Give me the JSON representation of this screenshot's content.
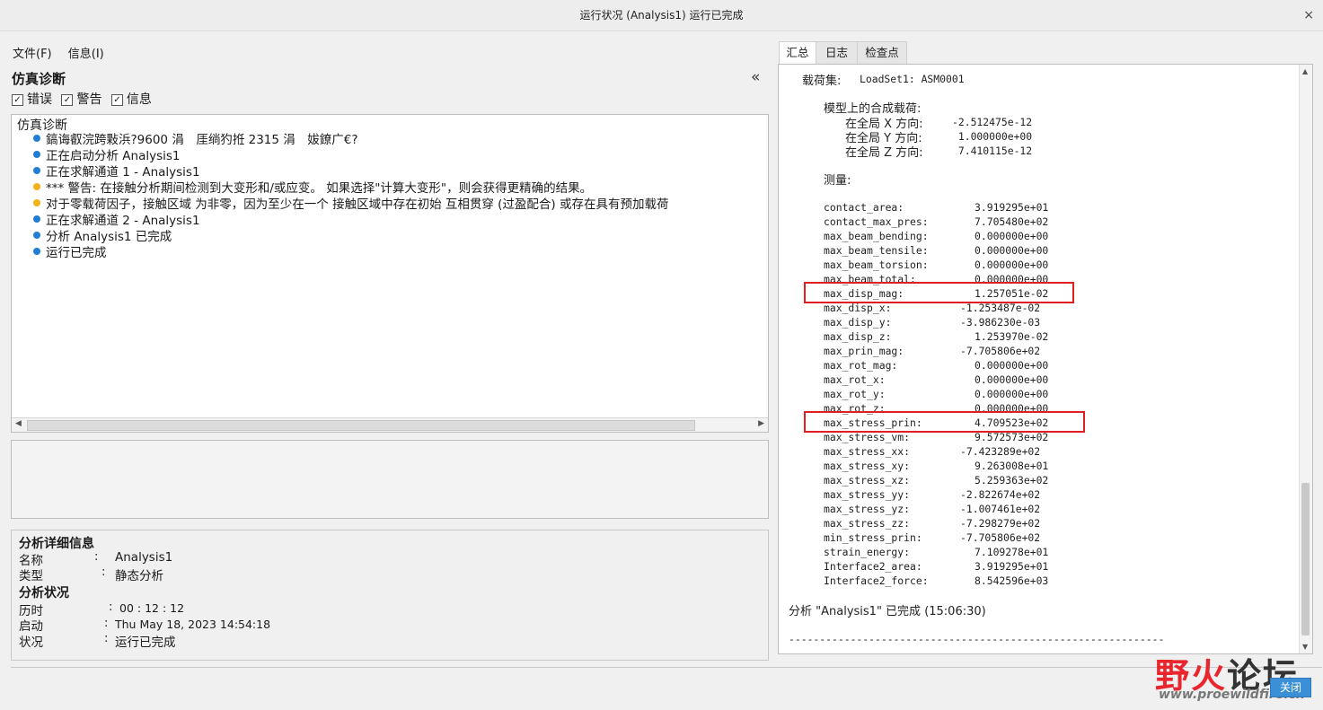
{
  "window": {
    "title": "运行状况 (Analysis1) 运行已完成",
    "close_glyph": "×"
  },
  "menu": {
    "file": "文件(F)",
    "info": "信息(I)"
  },
  "diagnostics": {
    "title": "仿真诊断",
    "collapse_glyph": "«",
    "filters": {
      "errors": "错误",
      "warnings": "警告",
      "info": "信息"
    },
    "tree_root": "仿真诊断",
    "colors": {
      "info": "#1f7fd6",
      "warning": "#f2b21c"
    },
    "messages": [
      {
        "kind": "info",
        "text": "鎬诲叡浣跨敤浜?9600 涓　厓绱犳拰 2315 涓　妭鐐广€?"
      },
      {
        "kind": "info",
        "text": "正在启动分析 Analysis1"
      },
      {
        "kind": "info",
        "text": "正在求解通道 1 - Analysis1"
      },
      {
        "kind": "warning",
        "text": "*** 警告: 在接触分析期间检测到大变形和/或应变。 如果选择\"计算大变形\"，则会获得更精确的结果。"
      },
      {
        "kind": "warning",
        "text": "对于零载荷因子，接触区域 为非零，因为至少在一个 接触区域中存在初始 互相贯穿 (过盈配合) 或存在具有预加载荷"
      },
      {
        "kind": "info",
        "text": "正在求解通道 2 - Analysis1"
      },
      {
        "kind": "info",
        "text": "分析 Analysis1 已完成"
      },
      {
        "kind": "info",
        "text": "运行已完成"
      }
    ]
  },
  "details": {
    "title": "分析详细信息",
    "name_label": "名称",
    "name_value": "Analysis1",
    "type_label": "类型",
    "type_value": "静态分析",
    "status_title": "分析状况",
    "elapsed_label": "历时",
    "elapsed_value": "00 : 12 : 12",
    "start_label": "启动",
    "start_value": "Thu May 18, 2023    14:54:18",
    "state_label": "状况",
    "state_value": "运行已完成"
  },
  "tabs": [
    "汇总",
    "日志",
    "检查点"
  ],
  "summary": {
    "loadset_label": "载荷集:",
    "loadset_value": "LoadSet1: ASM0001",
    "resultant_title": "模型上的合成载荷:",
    "resultants": [
      {
        "label": "在全局 X 方向:",
        "value": "-2.512475e-12"
      },
      {
        "label": "在全局 Y 方向:",
        "value": "1.000000e+00"
      },
      {
        "label": "在全局 Z 方向:",
        "value": "7.410115e-12"
      }
    ],
    "measures_title": "测量:",
    "measures": [
      {
        "name": "contact_area:",
        "value": "3.919295e+01"
      },
      {
        "name": "contact_max_pres:",
        "value": "7.705480e+02"
      },
      {
        "name": "max_beam_bending:",
        "value": "0.000000e+00"
      },
      {
        "name": "max_beam_tensile:",
        "value": "0.000000e+00"
      },
      {
        "name": "max_beam_torsion:",
        "value": "0.000000e+00"
      },
      {
        "name": "max_beam_total:",
        "value": "0.000000e+00"
      },
      {
        "name": "max_disp_mag:",
        "value": "1.257051e-02",
        "highlight": true
      },
      {
        "name": "max_disp_x:",
        "value": "-1.253487e-02"
      },
      {
        "name": "max_disp_y:",
        "value": "-3.986230e-03"
      },
      {
        "name": "max_disp_z:",
        "value": "1.253970e-02"
      },
      {
        "name": "max_prin_mag:",
        "value": "-7.705806e+02"
      },
      {
        "name": "max_rot_mag:",
        "value": "0.000000e+00"
      },
      {
        "name": "max_rot_x:",
        "value": "0.000000e+00"
      },
      {
        "name": "max_rot_y:",
        "value": "0.000000e+00"
      },
      {
        "name": "max_rot_z:",
        "value": "0.000000e+00"
      },
      {
        "name": "max_stress_prin:",
        "value": "4.709523e+02",
        "highlight": true
      },
      {
        "name": "max_stress_vm:",
        "value": "9.572573e+02"
      },
      {
        "name": "max_stress_xx:",
        "value": "-7.423289e+02"
      },
      {
        "name": "max_stress_xy:",
        "value": "9.263008e+01"
      },
      {
        "name": "max_stress_xz:",
        "value": "5.259363e+02"
      },
      {
        "name": "max_stress_yy:",
        "value": "-2.822674e+02"
      },
      {
        "name": "max_stress_yz:",
        "value": "-1.007461e+02"
      },
      {
        "name": "max_stress_zz:",
        "value": "-7.298279e+02"
      },
      {
        "name": "min_stress_prin:",
        "value": "-7.705806e+02"
      },
      {
        "name": "strain_energy:",
        "value": "7.109278e+01"
      },
      {
        "name": "Interface2_area:",
        "value": "3.919295e+01"
      },
      {
        "name": "Interface2_force:",
        "value": "8.542596e+03"
      }
    ],
    "completion": "分析 \"Analysis1\" 已完成 (15:06:30)",
    "separator": "-------------------------------------------------------------"
  },
  "watermark": {
    "main_red": "野火",
    "main_dark": "论坛",
    "sub": "www.proewildfire.cn"
  },
  "close_button": "关闭"
}
